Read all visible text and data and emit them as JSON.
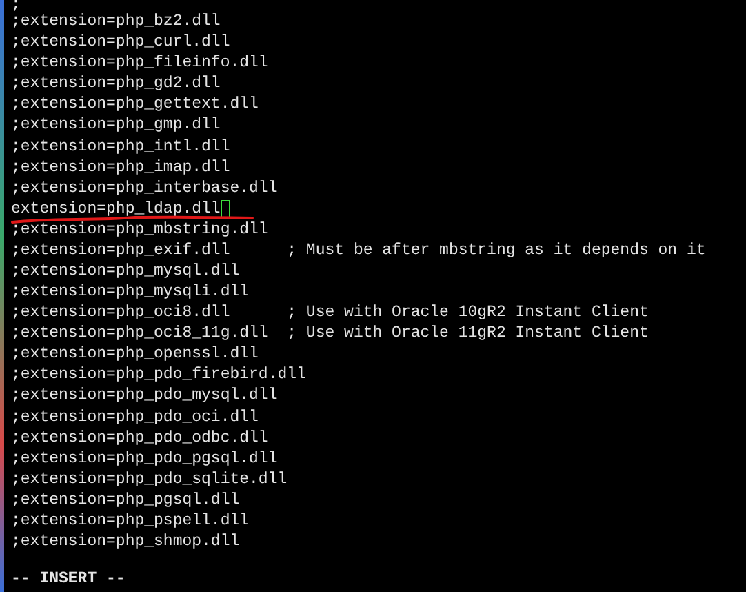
{
  "editor": {
    "lines": [
      {
        "text": ";",
        "cursor": false,
        "underlined": false
      },
      {
        "text": ";extension=php_bz2.dll",
        "cursor": false,
        "underlined": false
      },
      {
        "text": ";extension=php_curl.dll",
        "cursor": false,
        "underlined": false
      },
      {
        "text": ";extension=php_fileinfo.dll",
        "cursor": false,
        "underlined": false
      },
      {
        "text": ";extension=php_gd2.dll",
        "cursor": false,
        "underlined": false
      },
      {
        "text": ";extension=php_gettext.dll",
        "cursor": false,
        "underlined": false
      },
      {
        "text": ";extension=php_gmp.dll",
        "cursor": false,
        "underlined": false
      },
      {
        "text": ";extension=php_intl.dll",
        "cursor": false,
        "underlined": false
      },
      {
        "text": ";extension=php_imap.dll",
        "cursor": false,
        "underlined": false
      },
      {
        "text": ";extension=php_interbase.dll",
        "cursor": false,
        "underlined": false
      },
      {
        "text": "extension=php_ldap.dll",
        "cursor": true,
        "underlined": true
      },
      {
        "text": ";extension=php_mbstring.dll",
        "cursor": false,
        "underlined": false
      },
      {
        "text": ";extension=php_exif.dll      ; Must be after mbstring as it depends on it",
        "cursor": false,
        "underlined": false
      },
      {
        "text": ";extension=php_mysql.dll",
        "cursor": false,
        "underlined": false
      },
      {
        "text": ";extension=php_mysqli.dll",
        "cursor": false,
        "underlined": false
      },
      {
        "text": ";extension=php_oci8.dll      ; Use with Oracle 10gR2 Instant Client",
        "cursor": false,
        "underlined": false
      },
      {
        "text": ";extension=php_oci8_11g.dll  ; Use with Oracle 11gR2 Instant Client",
        "cursor": false,
        "underlined": false
      },
      {
        "text": ";extension=php_openssl.dll",
        "cursor": false,
        "underlined": false
      },
      {
        "text": ";extension=php_pdo_firebird.dll",
        "cursor": false,
        "underlined": false
      },
      {
        "text": ";extension=php_pdo_mysql.dll",
        "cursor": false,
        "underlined": false
      },
      {
        "text": ";extension=php_pdo_oci.dll",
        "cursor": false,
        "underlined": false
      },
      {
        "text": ";extension=php_pdo_odbc.dll",
        "cursor": false,
        "underlined": false
      },
      {
        "text": ";extension=php_pdo_pgsql.dll",
        "cursor": false,
        "underlined": false
      },
      {
        "text": ";extension=php_pdo_sqlite.dll",
        "cursor": false,
        "underlined": false
      },
      {
        "text": ";extension=php_pgsql.dll",
        "cursor": false,
        "underlined": false
      },
      {
        "text": ";extension=php_pspell.dll",
        "cursor": false,
        "underlined": false
      },
      {
        "text": ";extension=php_shmop.dll",
        "cursor": false,
        "underlined": false
      }
    ]
  },
  "status_bar": {
    "mode": "-- INSERT --"
  }
}
